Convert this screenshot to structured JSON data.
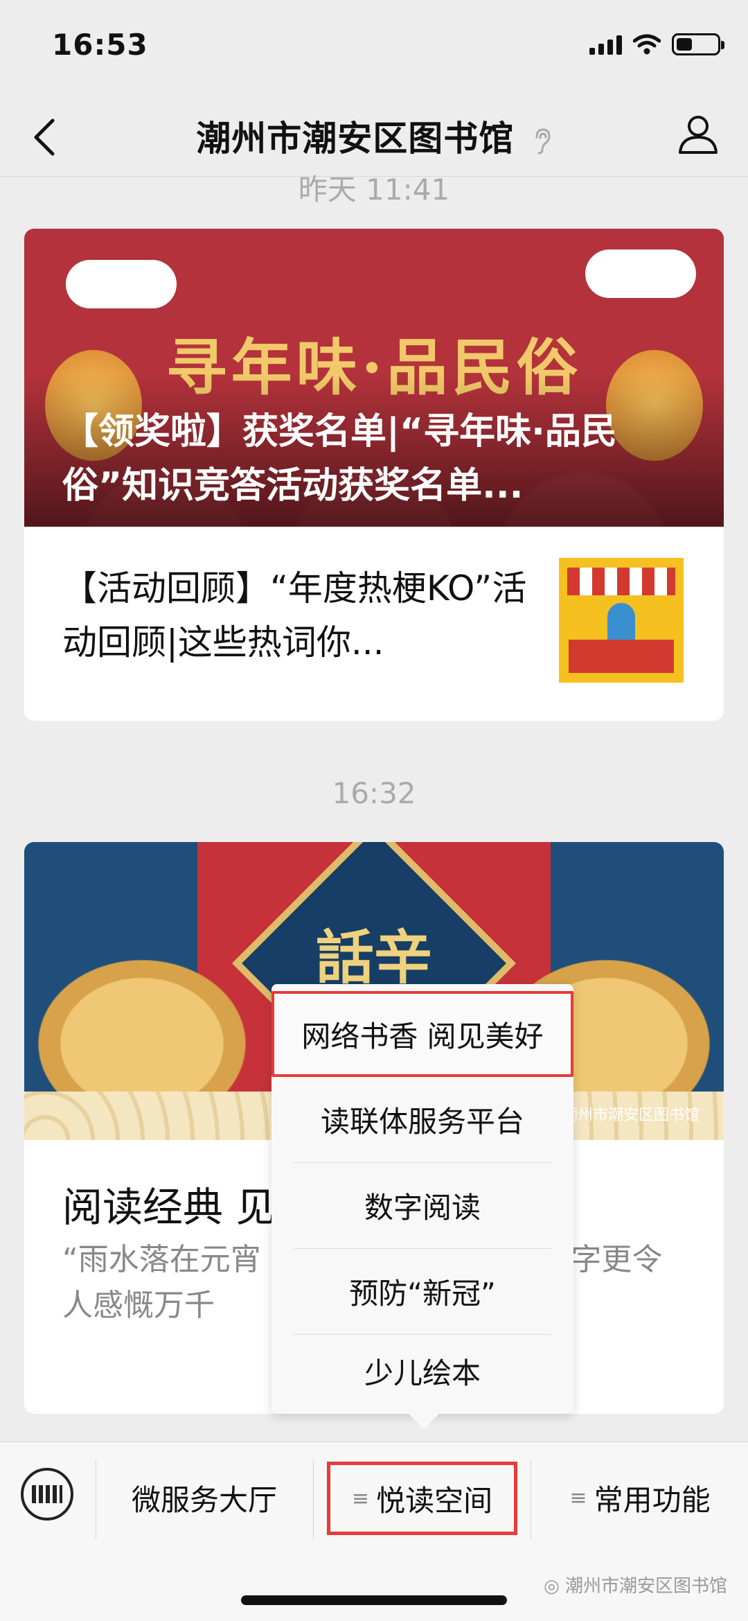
{
  "status": {
    "time": "16:53"
  },
  "nav": {
    "title": "潮州市潮安区图书馆"
  },
  "timestamps": {
    "first": "昨天 11:41",
    "second": "16:32"
  },
  "card1": {
    "banner_headline": "寻年味·品民俗",
    "banner_title": "【领奖啦】获奖名单|“寻年味·品民俗”知识竞答活动获奖名单...",
    "item_text": "【活动回顾】“年度热梗KO”活动回顾|这些热词你..."
  },
  "card2": {
    "banner_text": "話辛",
    "banner_caption": "潮州市潮安区图书馆",
    "title": "阅读经典 见",
    "desc": "“雨水落在元宵 。”回望已经过去的 ”四字更令人感慨万千"
  },
  "popup": {
    "items": [
      "网络书香 阅见美好",
      "读联体服务平台",
      "数字阅读",
      "预防“新冠”",
      "少儿绘本"
    ]
  },
  "menu": {
    "item1": "微服务大厅",
    "item2": "悦读空间",
    "item3": "常用功能"
  },
  "watermark": "潮州市潮安区图书馆",
  "colors": {
    "highlight": "#e53b3b",
    "background": "#ededed"
  }
}
